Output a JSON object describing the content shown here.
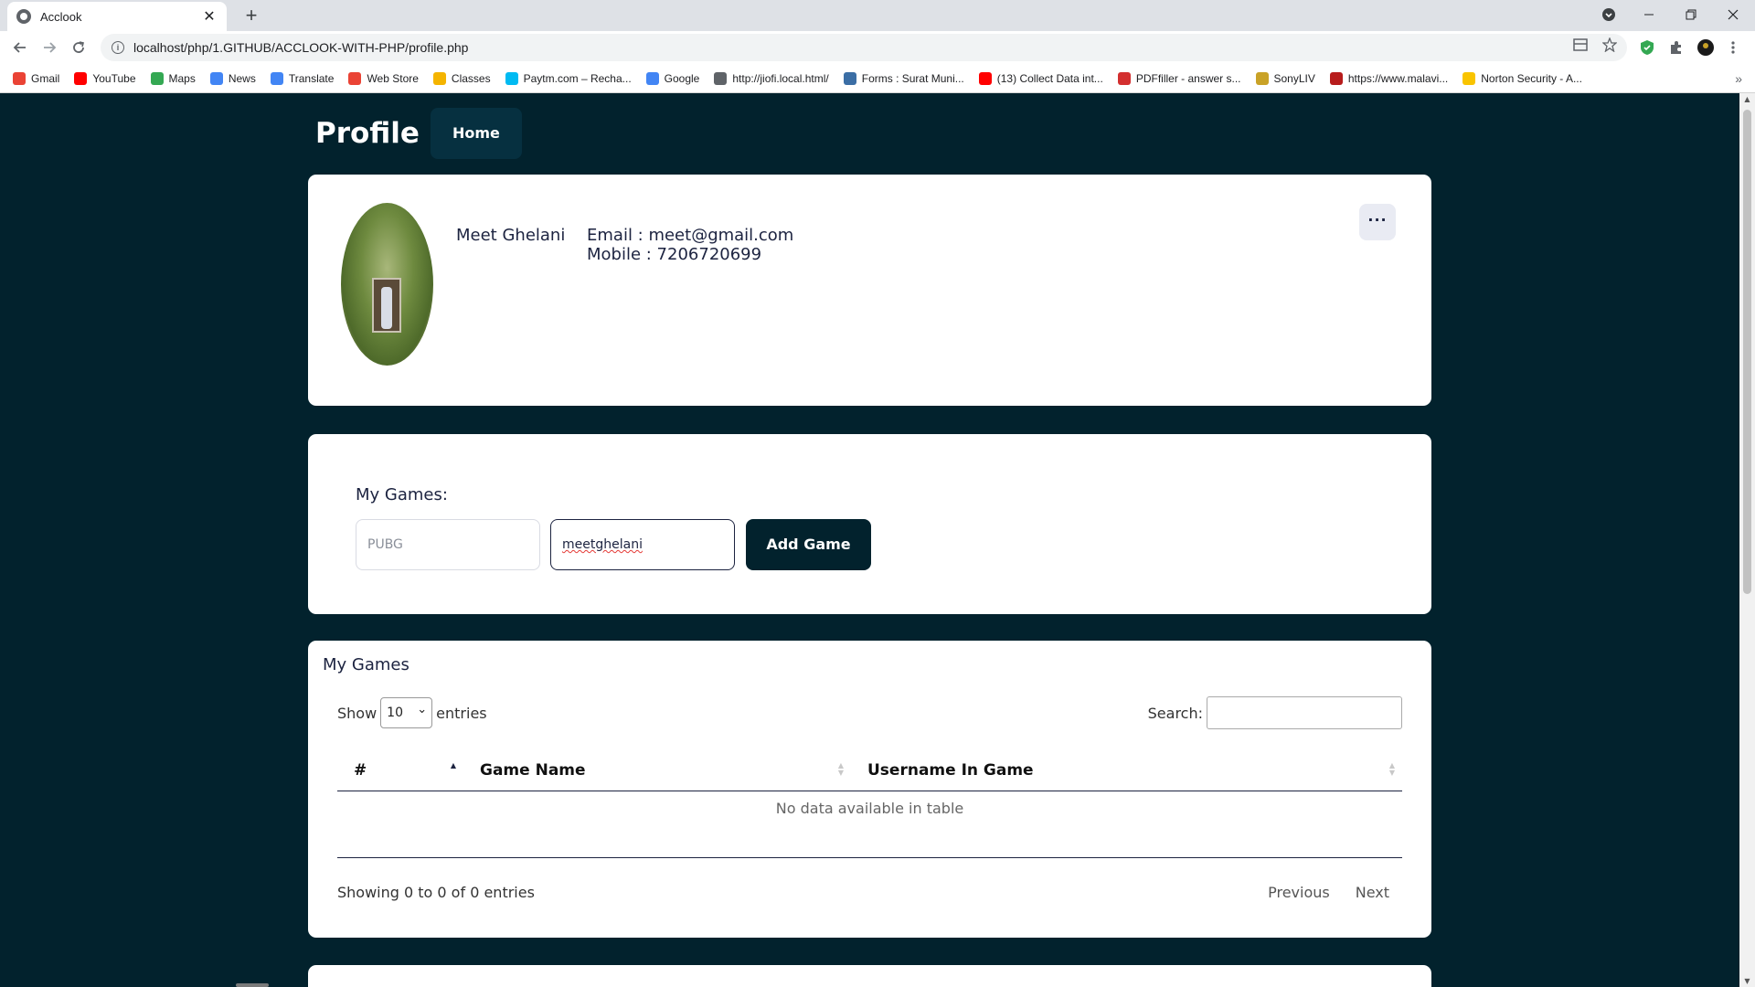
{
  "browser": {
    "tab_title": "Acclook",
    "new_tab": "+",
    "tab_close": "✕",
    "url": "localhost/php/1.GITHUB/ACCLOOK-WITH-PHP/profile.php",
    "bookmarks": [
      {
        "label": "Gmail",
        "color": "#ea4335"
      },
      {
        "label": "YouTube",
        "color": "#ff0000"
      },
      {
        "label": "Maps",
        "color": "#34a853"
      },
      {
        "label": "News",
        "color": "#4285f4"
      },
      {
        "label": "Translate",
        "color": "#4285f4"
      },
      {
        "label": "Web Store",
        "color": "#ea4335"
      },
      {
        "label": "Classes",
        "color": "#f4b400"
      },
      {
        "label": "Paytm.com – Recha...",
        "color": "#00baf2"
      },
      {
        "label": "Google",
        "color": "#4285f4"
      },
      {
        "label": "http://jiofi.local.html/",
        "color": "#5f6368"
      },
      {
        "label": "Forms : Surat Muni...",
        "color": "#3b6ea5"
      },
      {
        "label": "(13) Collect Data int...",
        "color": "#ff0000"
      },
      {
        "label": "PDFfiller - answer s...",
        "color": "#d32f2f"
      },
      {
        "label": "SonyLIV",
        "color": "#c9a227"
      },
      {
        "label": "https://www.malavi...",
        "color": "#b71c1c"
      },
      {
        "label": "Norton Security - A...",
        "color": "#f9c400"
      }
    ],
    "more_bookmarks": "»"
  },
  "header": {
    "title": "Profile",
    "home_label": "Home"
  },
  "profile": {
    "name": "Meet Ghelani",
    "email_line": "Email : meet@gmail.com",
    "mobile_line": "Mobile : 7206720699",
    "more_label": "···"
  },
  "add_game": {
    "label": "My Games:",
    "game_placeholder": "PUBG",
    "username_value": "meetghelani",
    "button_label": "Add Game"
  },
  "games_table": {
    "title": "My Games",
    "show_label": "Show",
    "entries_value": "10",
    "entries_label": "entries",
    "search_label": "Search:",
    "columns": [
      "#",
      "Game Name",
      "Username In Game"
    ],
    "empty_text": "No data available in table",
    "info_text": "Showing 0 to 0 of 0 entries",
    "prev_label": "Previous",
    "next_label": "Next"
  },
  "colors": {
    "page_bg": "#02222d",
    "accent": "#063040",
    "text": "#1c2340"
  }
}
